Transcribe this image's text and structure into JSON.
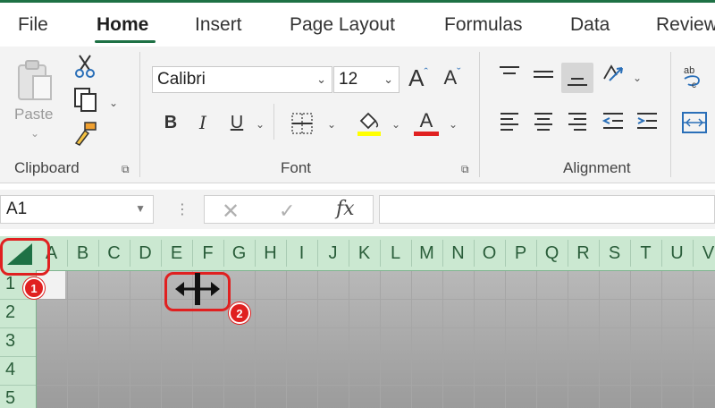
{
  "tabs": [
    {
      "label": "File"
    },
    {
      "label": "Home"
    },
    {
      "label": "Insert"
    },
    {
      "label": "Page Layout"
    },
    {
      "label": "Formulas"
    },
    {
      "label": "Data"
    },
    {
      "label": "Review"
    }
  ],
  "active_tab": "Home",
  "ribbon": {
    "clipboard": {
      "label": "Clipboard",
      "paste_label": "Paste"
    },
    "font": {
      "label": "Font",
      "font_name": "Calibri",
      "font_size": "12",
      "grow_label": "A",
      "shrink_label": "A",
      "bold_label": "B",
      "italic_label": "I",
      "underline_label": "U",
      "font_color_label": "A"
    },
    "alignment": {
      "label": "Alignment"
    }
  },
  "formula_bar": {
    "name_box": "A1",
    "fx_label": "fx",
    "formula_value": ""
  },
  "grid": {
    "columns": [
      "A",
      "B",
      "C",
      "D",
      "E",
      "F",
      "G",
      "H",
      "I",
      "J",
      "K",
      "L",
      "M",
      "N",
      "O",
      "P",
      "Q",
      "R",
      "S",
      "T",
      "U",
      "V"
    ],
    "rows": [
      "1",
      "2",
      "3",
      "4",
      "5"
    ]
  },
  "callouts": [
    {
      "number": "1",
      "target": "select-all-corner"
    },
    {
      "number": "2",
      "target": "move-cursor"
    }
  ],
  "colors": {
    "accent": "#1e7145",
    "header_bg": "#cbe8d1",
    "callout": "#e02020",
    "highlight_yellow": "#ffff00",
    "font_red": "#e02020"
  }
}
